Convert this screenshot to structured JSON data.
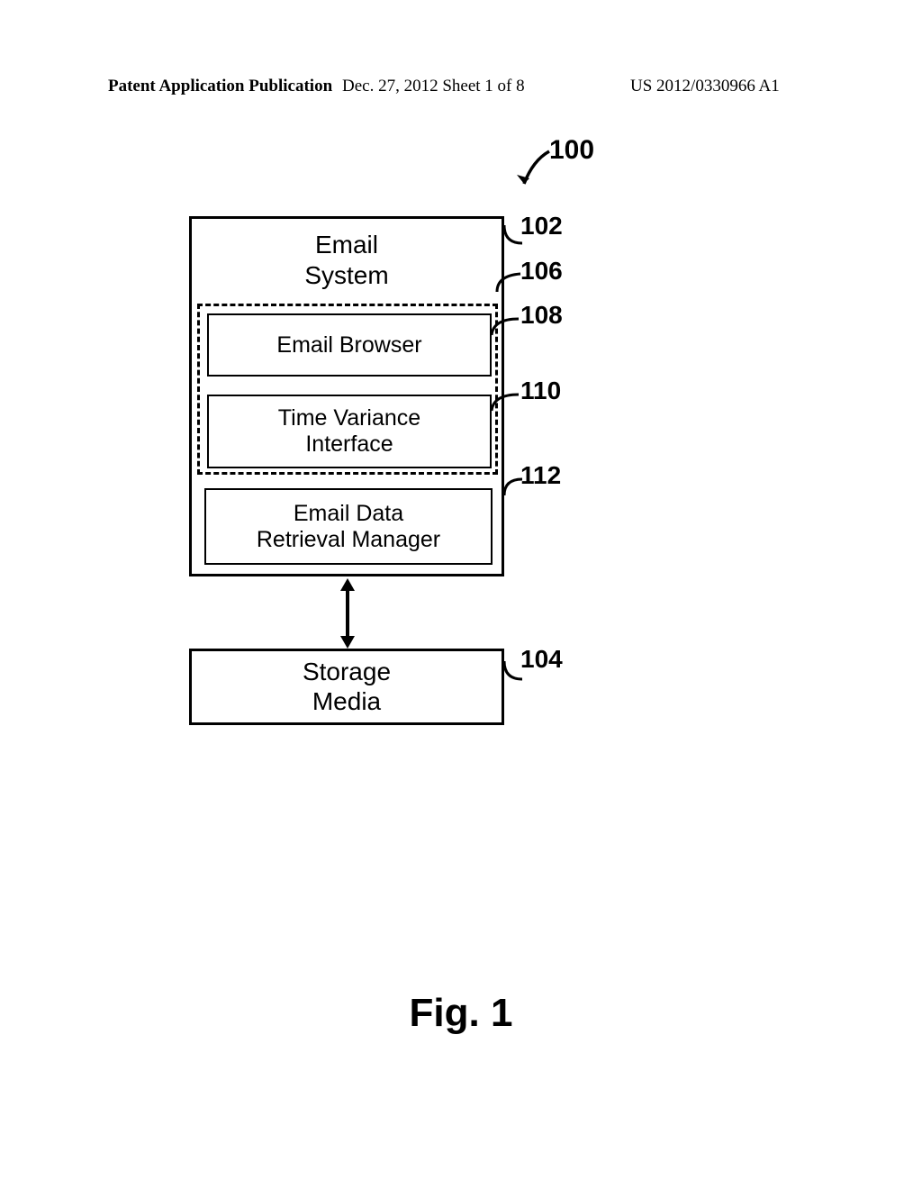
{
  "header": {
    "left": "Patent Application Publication",
    "center": "Dec. 27, 2012  Sheet 1 of 8",
    "right": "US 2012/0330966 A1"
  },
  "refs": {
    "system": "100",
    "email_system": "102",
    "storage_media": "104",
    "dashed_group": "106",
    "email_browser": "108",
    "time_variance": "110",
    "email_data_mgr": "112"
  },
  "boxes": {
    "email_system_title": "Email\nSystem",
    "email_browser": "Email Browser",
    "time_variance": "Time Variance\nInterface",
    "email_data_mgr": "Email Data\nRetrieval Manager",
    "storage_media": "Storage\nMedia"
  },
  "caption": "Fig. 1"
}
